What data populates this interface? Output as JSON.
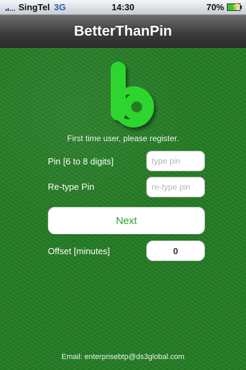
{
  "status_bar": {
    "carrier": "SingTel",
    "network": "3G",
    "time": "14:30",
    "battery": "70%"
  },
  "nav": {
    "title": "BetterThanPin"
  },
  "logo": {
    "icon": "b-logo-icon",
    "color": "#2ecc2e"
  },
  "form": {
    "intro": "First time user, please register.",
    "pin_label": "Pin [6 to 8 digits]",
    "pin_placeholder": "type pin",
    "retype_label": "Re-type Pin",
    "retype_placeholder": "re-type pin",
    "next_label": "Next",
    "offset_label": "Offset [minutes]",
    "offset_value": "0"
  },
  "footer": {
    "email": "Email: enterprisebtp@ds3global.com"
  },
  "colors": {
    "background": "#247d24",
    "accent": "#2aa52a"
  }
}
